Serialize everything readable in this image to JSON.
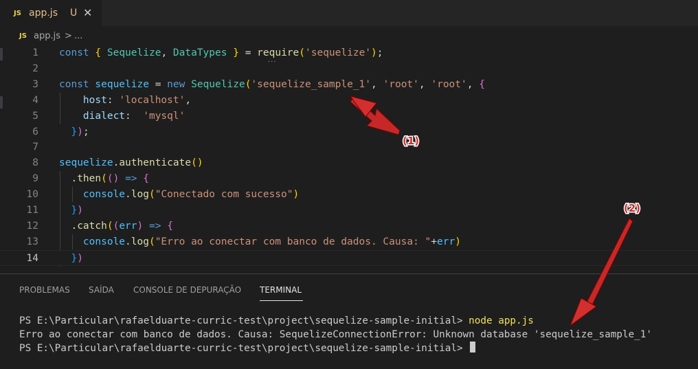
{
  "tab": {
    "badge": "JS",
    "filename": "app.js",
    "status": "U",
    "close": "✕"
  },
  "breadcrumb": {
    "badge": "JS",
    "file": "app.js",
    "separator": ">",
    "more": "..."
  },
  "editor": {
    "current_line": 14,
    "line_numbers": [
      "1",
      "2",
      "3",
      "4",
      "5",
      "6",
      "7",
      "8",
      "9",
      "10",
      "11",
      "12",
      "13",
      "14"
    ],
    "lines": [
      "const { Sequelize, DataTypes } = require('sequelize');",
      "",
      "const sequelize = new Sequelize('sequelize_sample_1', 'root', 'root', {",
      "    host: 'localhost',",
      "    dialect:  'mysql'",
      "  });",
      "",
      "sequelize.authenticate()",
      "  .then(() => {",
      "    console.log(\"Conectado com sucesso\")",
      "  })",
      "  .catch((err) => {",
      "    console.log(\"Erro ao conectar com banco de dados. Causa: \"+err)",
      "  })"
    ]
  },
  "panel": {
    "tabs": [
      "PROBLEMAS",
      "SAÍDA",
      "CONSOLE DE DEPURAÇÃO",
      "TERMINAL"
    ],
    "active_tab": "TERMINAL"
  },
  "terminal": {
    "prompt1": "PS E:\\Particular\\rafaelduarte-curric-test\\project\\sequelize-sample-initial> ",
    "command": "node app.js",
    "output": "Erro ao conectar com banco de dados. Causa: SequelizeConnectionError: Unknown database 'sequelize_sample_1'",
    "prompt2": "PS E:\\Particular\\rafaelduarte-curric-test\\project\\sequelize-sample-initial> "
  },
  "annotations": {
    "label1": "(1)",
    "label2": "(2)",
    "color": "#d32f2f"
  },
  "colors": {
    "keyword": "#569cd6",
    "string": "#ce9178",
    "function": "#dcdcaa",
    "class": "#4ec9b0",
    "property": "#9cdcfe",
    "background": "#1e1e1e"
  }
}
